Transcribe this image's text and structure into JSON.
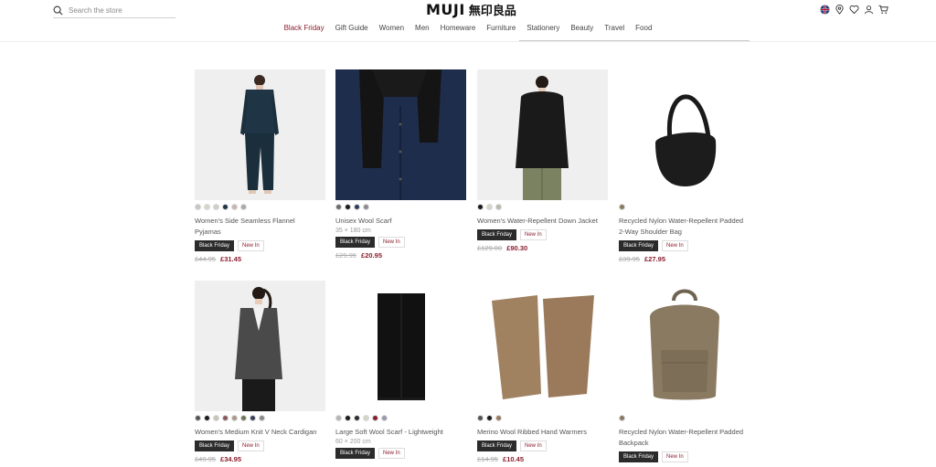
{
  "header": {
    "search_placeholder": "Search the store",
    "logo_latin": "MUJI",
    "logo_kanji": "無印良品",
    "icons": [
      "flag-uk-icon",
      "location-pin-icon",
      "heart-icon",
      "user-icon",
      "cart-icon"
    ]
  },
  "nav": [
    {
      "label": "Black Friday"
    },
    {
      "label": "Gift Guide"
    },
    {
      "label": "Women"
    },
    {
      "label": "Men"
    },
    {
      "label": "Homeware"
    },
    {
      "label": "Furniture"
    },
    {
      "label": "Stationery"
    },
    {
      "label": "Beauty"
    },
    {
      "label": "Travel"
    },
    {
      "label": "Food"
    }
  ],
  "products": [
    {
      "name_line1": "Women's Side Seamless Flannel",
      "name_line2": "Pyjamas",
      "size": "",
      "badge1": "Black Friday",
      "badge2": "New In",
      "was": "£44.95",
      "now": "£31.45",
      "swatches": [
        "#c5c5c5",
        "#d8d4c8",
        "#cfcfc7",
        "#1f3444",
        "#c9b3b8",
        "#a9a9a9"
      ]
    },
    {
      "name_line1": "Unisex Wool Scarf",
      "name_line2": "",
      "size": "35 × 180 cm",
      "badge1": "Black Friday",
      "badge2": "New In",
      "was": "£29.95",
      "now": "£20.95",
      "swatches": [
        "#6c6c6c",
        "#1b1b1b",
        "#2e3e5a",
        "#8b8b8b"
      ]
    },
    {
      "name_line1": "Women's Water-Repellent Down Jacket",
      "name_line2": "",
      "size": "",
      "badge1": "Black Friday",
      "badge2": "New In",
      "was": "£129.00",
      "now": "£90.30",
      "swatches": [
        "#1b1b1b",
        "#d8d4c8",
        "#b8b8b0"
      ]
    },
    {
      "name_line1": "Recycled Nylon Water-Repellent Padded",
      "name_line2": "2-Way Shoulder Bag",
      "size": "",
      "badge1": "Black Friday",
      "badge2": "New In",
      "was": "£39.95",
      "now": "£27.95",
      "swatches": [
        "#8a7a62"
      ]
    },
    {
      "name_line1": "Women's Medium Knit V Neck Cardigan",
      "name_line2": "",
      "size": "",
      "badge1": "Black Friday",
      "badge2": "New In",
      "was": "£49.95",
      "now": "£34.95",
      "swatches": [
        "#555555",
        "#1b1b1b",
        "#c9c4b8",
        "#8a5a5a",
        "#a89a8a",
        "#6b7456",
        "#3a3f5a",
        "#8a8a8a"
      ]
    },
    {
      "name_line1": "Large Soft Wool Scarf - Lightweight",
      "name_line2": "",
      "size": "60 × 200 cm",
      "badge1": "Black Friday",
      "badge2": "New In",
      "was": "",
      "now": "",
      "swatches": [
        "#b5b5b5",
        "#1b1b1b",
        "#2e2e2e",
        "#d8d4c8",
        "#8b1e2e",
        "#9a9aaa"
      ]
    },
    {
      "name_line1": "Merino Wool Ribbed Hand Warmers",
      "name_line2": "",
      "size": "",
      "badge1": "Black Friday",
      "badge2": "New In",
      "was": "£14.95",
      "now": "£10.45",
      "swatches": [
        "#555555",
        "#1b1b1b",
        "#9a7c5c"
      ]
    },
    {
      "name_line1": "Recycled Nylon Water-Repellent Padded",
      "name_line2": "Backpack",
      "size": "",
      "badge1": "Black Friday",
      "badge2": "New In",
      "was": "",
      "now": "",
      "swatches": [
        "#8a7a62"
      ]
    }
  ]
}
